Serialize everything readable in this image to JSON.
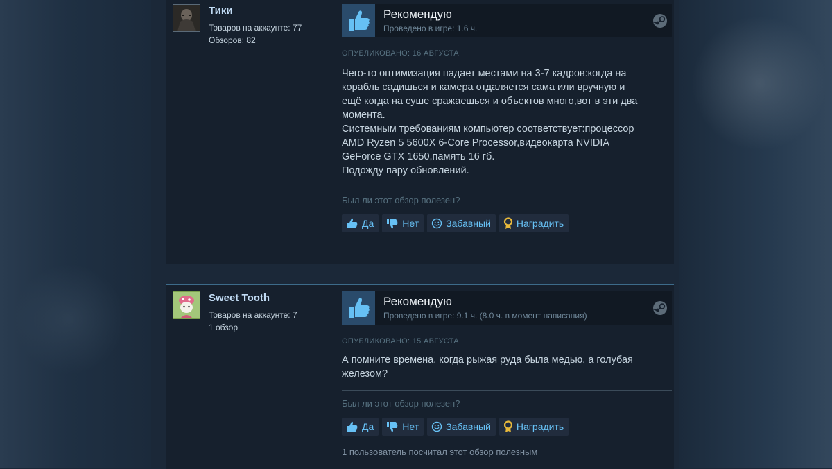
{
  "reviews": [
    {
      "author": {
        "name": "Тики",
        "products": "Товаров на аккаунте: 77",
        "reviews": "Обзоров: 82"
      },
      "recommendation": "Рекомендую",
      "hours": "Проведено в игре: 1.6 ч.",
      "posted": "ОПУБЛИКОВАНО: 16 АВГУСТА",
      "lines": [
        "Чего-то оптимизация падает местами на 3-7 кадров:когда на",
        "корабль садишься и камера отдаляется сама или вручную и",
        "ещё когда на суше сражаешься и объектов много,вот в эти два",
        "момента.",
        "Системным требованиям компьютер соответствует:процессор",
        "AMD Ryzen 5 5600X 6-Core Processor,видеокарта NVIDIA",
        "GeForce GTX 1650,память 16 гб.",
        "Подожду пару обновлений."
      ],
      "helpful_question": "Был ли этот обзор полезен?",
      "buttons": {
        "yes": "Да",
        "no": "Нет",
        "funny": "Забавный",
        "award": "Наградить"
      }
    },
    {
      "author": {
        "name": "Sweet Tooth",
        "products": "Товаров на аккаунте: 7",
        "reviews": "1 обзор"
      },
      "recommendation": "Рекомендую",
      "hours": "Проведено в игре: 9.1 ч. (8.0 ч. в момент написания)",
      "posted": "ОПУБЛИКОВАНО: 15 АВГУСТА",
      "lines": [
        "А помните времена, когда рыжая руда была медью, а голубая",
        "железом?"
      ],
      "helpful_question": "Был ли этот обзор полезен?",
      "buttons": {
        "yes": "Да",
        "no": "Нет",
        "funny": "Забавный",
        "award": "Наградить"
      },
      "helpful_count": "1 пользователь посчитал этот обзор полезным"
    }
  ],
  "colors": {
    "background": "#1b2838",
    "panel": "#16202d",
    "link": "#67c1f5",
    "author": "#c1dbf4",
    "award": "#e8b93b"
  },
  "icons": [
    "thumbs-up-icon",
    "thumbs-down-icon",
    "smiley-icon",
    "award-icon",
    "steam-logo-icon"
  ]
}
